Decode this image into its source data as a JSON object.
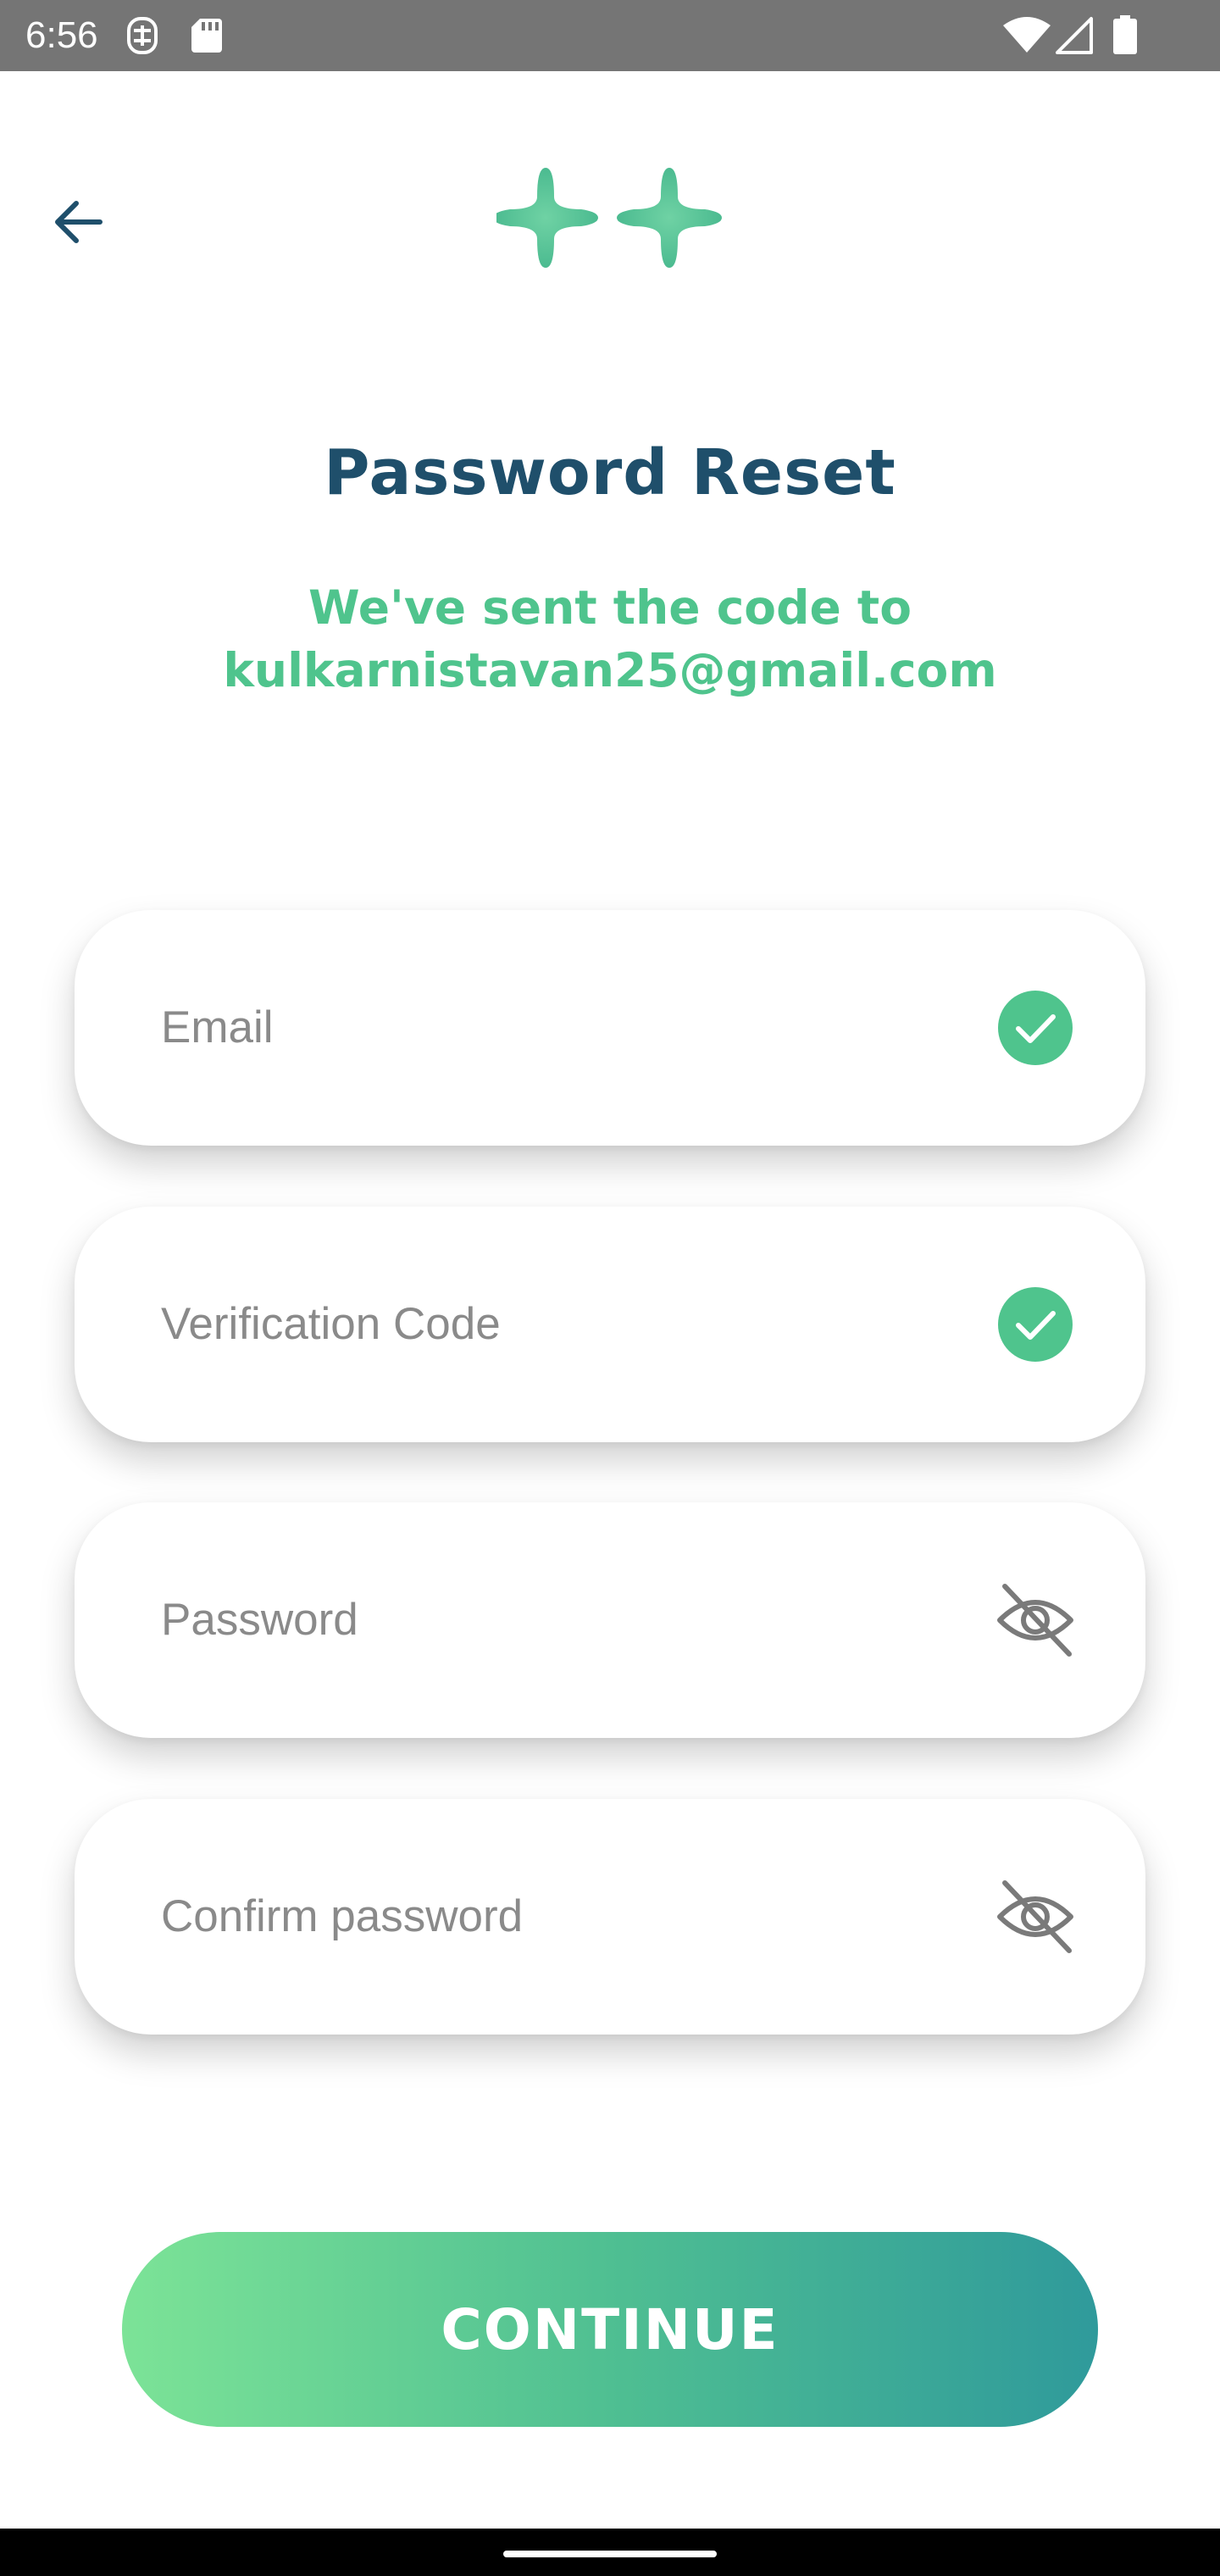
{
  "status_bar": {
    "time": "6:56",
    "left_icons": [
      "sim-toolkit-icon",
      "sd-card-icon"
    ],
    "right_icons": [
      "wifi-icon",
      "cell-signal-icon",
      "battery-icon"
    ]
  },
  "header": {
    "back_icon": "arrow-left-icon",
    "logo_icon": "double-cross-logo"
  },
  "title": "Password Reset",
  "subtitle": {
    "line1": "We've sent the code to",
    "line2": "kulkarnistavan25@gmail.com"
  },
  "fields": {
    "email": {
      "placeholder": "Email",
      "icon": "check-circle-icon"
    },
    "verification": {
      "placeholder": "Verification Code",
      "icon": "check-circle-icon"
    },
    "password": {
      "placeholder": "Password",
      "icon": "eye-off-icon"
    },
    "confirm": {
      "placeholder": "Confirm password",
      "icon": "eye-off-icon"
    }
  },
  "continue_label": "CONTINUE",
  "colors": {
    "title": "#1f4f6b",
    "accent_green": "#4fc48d",
    "button_gradient_start": "#7ce397",
    "button_gradient_end": "#2f9a9b",
    "status_bar": "#757575"
  }
}
